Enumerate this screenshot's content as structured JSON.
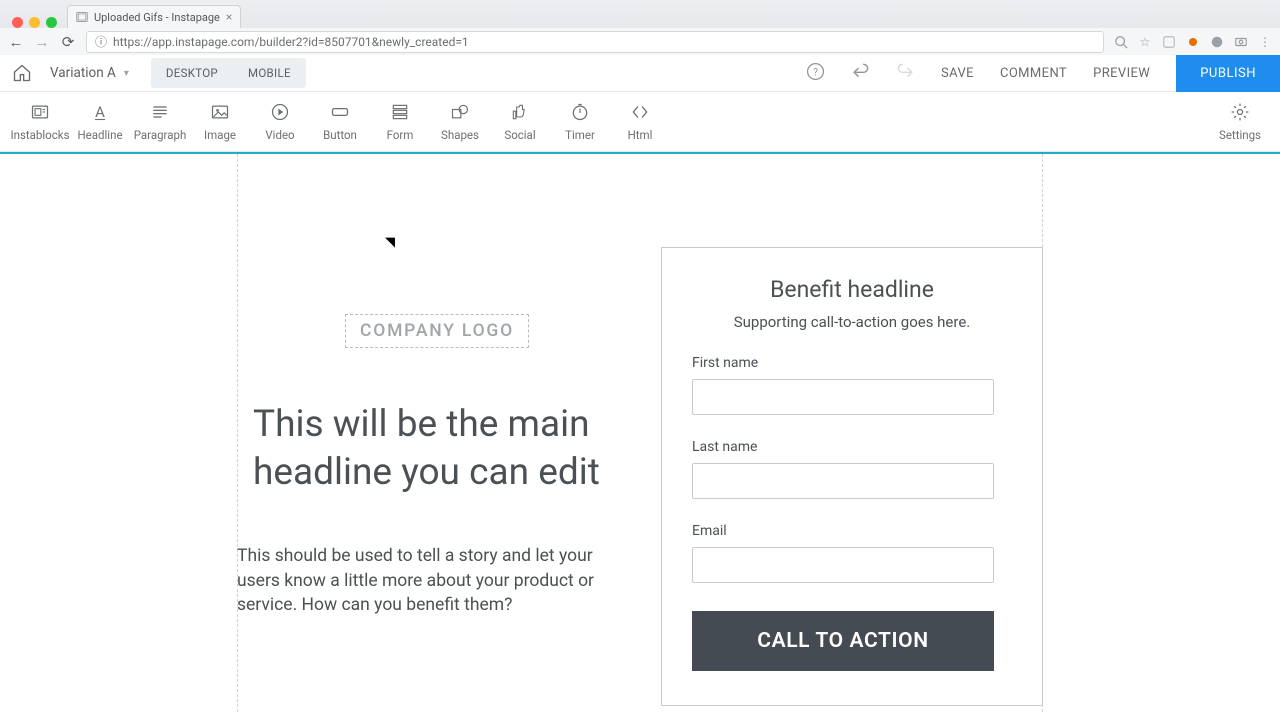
{
  "browser": {
    "tab_title": "Uploaded Gifs - Instapage",
    "url": "https://app.instapage.com/builder2?id=8507701&newly_created=1"
  },
  "header": {
    "variation_label": "Variation A",
    "view_desktop": "DESKTOP",
    "view_mobile": "MOBILE",
    "save": "SAVE",
    "comment": "COMMENT",
    "preview": "PREVIEW",
    "publish": "PUBLISH"
  },
  "tools": {
    "instablocks": "Instablocks",
    "headline": "Headline",
    "paragraph": "Paragraph",
    "image": "Image",
    "video": "Video",
    "button": "Button",
    "form": "Form",
    "shapes": "Shapes",
    "social": "Social",
    "timer": "Timer",
    "html": "Html",
    "settings": "Settings"
  },
  "canvas": {
    "logo_placeholder": "COMPANY LOGO",
    "main_headline": "This will be the main headline you can edit",
    "story_text": "This should be used to tell a story and let your users know a little more about your product or service. How can you benefit them?",
    "form": {
      "title": "Benefit headline",
      "subtitle": "Supporting call-to-action goes here.",
      "first_name_label": "First name",
      "last_name_label": "Last name",
      "email_label": "Email",
      "cta_label": "CALL TO ACTION"
    }
  }
}
